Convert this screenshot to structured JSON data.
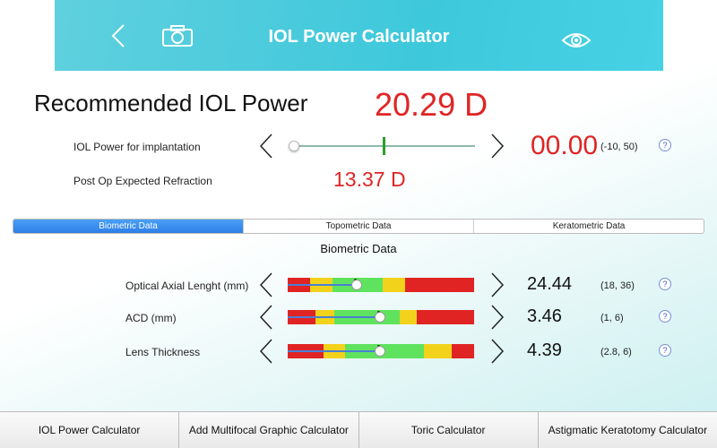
{
  "header": {
    "title": "IOL Power Calculator",
    "icons": [
      "back-icon",
      "camera-icon",
      "eye-icon"
    ],
    "accent": "#3ec8dc"
  },
  "recommended": {
    "label": "Recommended IOL Power",
    "value": "20.29 D"
  },
  "implantation": {
    "label": "IOL Power for implantation",
    "value": "00.00",
    "range": "(-10, 50)",
    "help": "?"
  },
  "refraction": {
    "label": "Post Op Expected Refraction",
    "value": "13.37 D"
  },
  "tabs": [
    {
      "label": "Biometric Data",
      "active": true
    },
    {
      "label": "Topometric Data",
      "active": false
    },
    {
      "label": "Keratometric Data",
      "active": false
    }
  ],
  "section": {
    "title": "Biometric Data"
  },
  "rows": [
    {
      "label": "Optical Axial Lenght (mm)",
      "value": "24.44",
      "range": "(18, 36)",
      "help": "?"
    },
    {
      "label": "ACD (mm)",
      "value": "3.46",
      "range": "(1, 6)",
      "help": "?"
    },
    {
      "label": "Lens Thickness",
      "value": "4.39",
      "range": "(2.8, 6)",
      "help": "?"
    }
  ],
  "colors": {
    "red": "#e02424",
    "yellow": "#f2d21b",
    "green": "#5fe35f",
    "blue_line": "#4a7fd6",
    "active_tab": "#2d7ee8"
  },
  "bottom": {
    "buttons": [
      "IOL Power Calculator",
      "Add Multifocal Graphic Calculator",
      "Toric Calculator",
      "Astigmatic Keratotomy Calculator"
    ]
  }
}
